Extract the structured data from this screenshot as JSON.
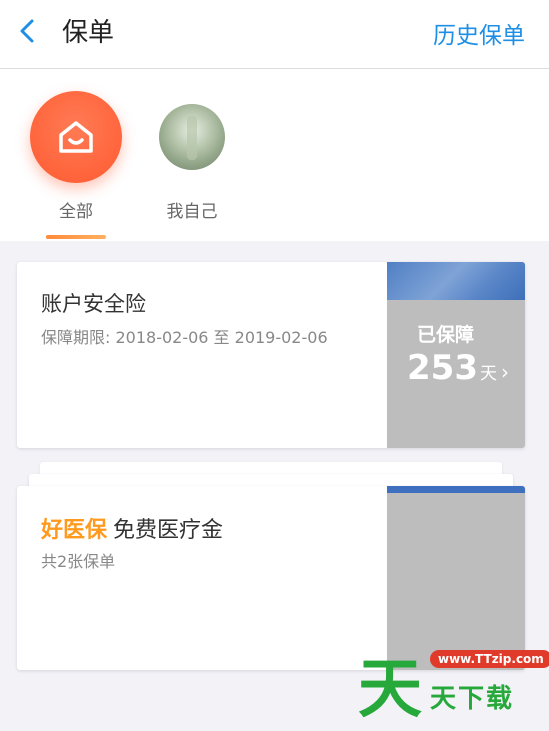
{
  "header": {
    "title": "保单",
    "history_label": "历史保单"
  },
  "filters": [
    {
      "label": "全部",
      "selected": true
    },
    {
      "label": "我自己",
      "selected": false
    }
  ],
  "policies": [
    {
      "title": "账户安全险",
      "period": "保障期限: 2018-02-06 至 2019-02-06",
      "status_label": "已保障",
      "days_value": "253",
      "days_unit": "天"
    },
    {
      "brand": "好医保",
      "title": "免费医疗金",
      "count_text": "共2张保单"
    }
  ],
  "watermark": {
    "big": "天",
    "site": "www.TTzip.com",
    "text": "天下载"
  },
  "colors": {
    "accent": "#1f8fe6",
    "orange": "#ff9a1e",
    "active": "#ff5a30"
  }
}
